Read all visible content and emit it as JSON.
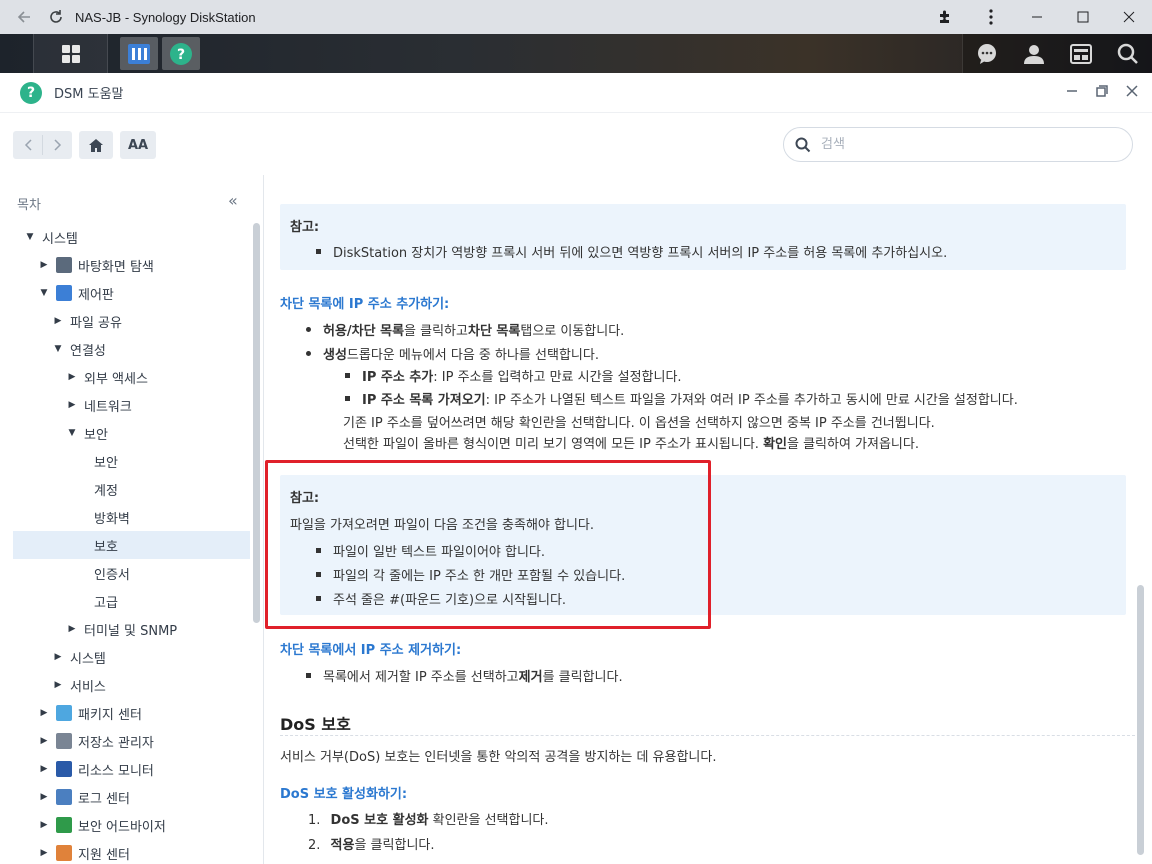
{
  "browser": {
    "title": "NAS-JB - Synology DiskStation",
    "back_icon": "arrow-left-icon",
    "reload_icon": "reload-icon"
  },
  "window": {
    "title": "DSM 도움말"
  },
  "toolbar": {
    "font_size_label": "AA",
    "search_placeholder": "검색"
  },
  "sidebar": {
    "toc_label": "목차",
    "collapse_label": "«",
    "items": [
      {
        "label": "시스템",
        "level": 0,
        "arrow": "down"
      },
      {
        "label": "바탕화면 탐색",
        "level": 1,
        "arrow": "right",
        "icon": "desktop-icon"
      },
      {
        "label": "제어판",
        "level": 1,
        "arrow": "down",
        "icon": "control-panel-icon"
      },
      {
        "label": "파일 공유",
        "level": 2,
        "arrow": "right"
      },
      {
        "label": "연결성",
        "level": 2,
        "arrow": "down"
      },
      {
        "label": "외부 액세스",
        "level": 3,
        "arrow": "right"
      },
      {
        "label": "네트워크",
        "level": 3,
        "arrow": "right"
      },
      {
        "label": "보안",
        "level": 3,
        "arrow": "down"
      },
      {
        "label": "보안",
        "level": 4,
        "arrow": ""
      },
      {
        "label": "계정",
        "level": 4,
        "arrow": ""
      },
      {
        "label": "방화벽",
        "level": 4,
        "arrow": ""
      },
      {
        "label": "보호",
        "level": 4,
        "arrow": "",
        "selected": true
      },
      {
        "label": "인증서",
        "level": 4,
        "arrow": ""
      },
      {
        "label": "고급",
        "level": 4,
        "arrow": ""
      },
      {
        "label": "터미널 및 SNMP",
        "level": 3,
        "arrow": "right"
      },
      {
        "label": "시스템",
        "level": 2,
        "arrow": "right"
      },
      {
        "label": "서비스",
        "level": 2,
        "arrow": "right"
      },
      {
        "label": "패키지 센터",
        "level": 1,
        "arrow": "right",
        "icon": "package-icon"
      },
      {
        "label": "저장소 관리자",
        "level": 1,
        "arrow": "right",
        "icon": "storage-icon"
      },
      {
        "label": "리소스 모니터",
        "level": 1,
        "arrow": "right",
        "icon": "monitor-icon"
      },
      {
        "label": "로그 센터",
        "level": 1,
        "arrow": "right",
        "icon": "log-icon"
      },
      {
        "label": "보안 어드바이저",
        "level": 1,
        "arrow": "right",
        "icon": "advisor-icon"
      },
      {
        "label": "지원 센터",
        "level": 1,
        "arrow": "right",
        "icon": "support-icon"
      }
    ]
  },
  "content": {
    "note1": {
      "title": "참고:",
      "bullet": "DiskStation 장치가 역방향 프록시 서버 뒤에 있으면 역방향 프록시 서버의 IP 주소를 허용 목록에 추가하십시오."
    },
    "add_block": {
      "heading": "차단 목록에 IP 주소 추가하기:",
      "b1_bold": "허용/차단 목록",
      "b1_mid": "을 클릭하고 ",
      "b1_bold2": "차단 목록",
      "b1_end": " 탭으로 이동합니다.",
      "b2_bold": "생성",
      "b2_end": " 드롭다운 메뉴에서 다음 중 하나를 선택합니다.",
      "sub1_bold": "IP 주소 추가",
      "sub1_end": ": IP 주소를 입력하고 만료 시간을 설정합니다.",
      "sub2_bold": "IP 주소 목록 가져오기",
      "sub2_end": ": IP 주소가 나열된 텍스트 파일을 가져와 여러 IP 주소를 추가하고 동시에 만료 시간을 설정합니다.",
      "sub2_line2": "기존 IP 주소를 덮어쓰려면 해당 확인란을 선택합니다. 이 옵션을 선택하지 않으면 중복 IP 주소를 건너뜁니다.",
      "sub2_line3_start": "선택한 파일이 올바른 형식이면 미리 보기 영역에 모든 IP 주소가 표시됩니다. ",
      "sub2_line3_bold": "확인",
      "sub2_line3_end": "을 클릭하여 가져옵니다."
    },
    "note2": {
      "title": "참고:",
      "intro": "파일을 가져오려면 파일이 다음 조건을 충족해야 합니다.",
      "bullets": [
        "파일이 일반 텍스트 파일이어야 합니다.",
        "파일의 각 줄에는 IP 주소 한 개만 포함될 수 있습니다.",
        "주석 줄은 #(파운드 기호)으로 시작됩니다."
      ]
    },
    "remove_block": {
      "heading": "차단 목록에서 IP 주소 제거하기:",
      "b1_start": "목록에서 제거할 IP 주소를 선택하고 ",
      "b1_bold": "제거",
      "b1_end": "를 클릭합니다."
    },
    "dos": {
      "heading": "DoS 보호",
      "desc": "서비스 거부(DoS) 보호는 인터넷을 통한 악의적 공격을 방지하는 데 유용합니다.",
      "sub_heading": "DoS 보호 활성화하기:",
      "step1_num": "1.",
      "step1_bold": "DoS 보호 활성화",
      "step1_end": " 확인란을 선택합니다.",
      "step2_num": "2.",
      "step2_bold": "적용",
      "step2_end": "을 클릭합니다."
    }
  },
  "colors": {
    "accent": "#2b78d0",
    "note_bg": "#ecf4fc",
    "highlight": "#e0202a",
    "selected_bg": "#e4eef9"
  }
}
